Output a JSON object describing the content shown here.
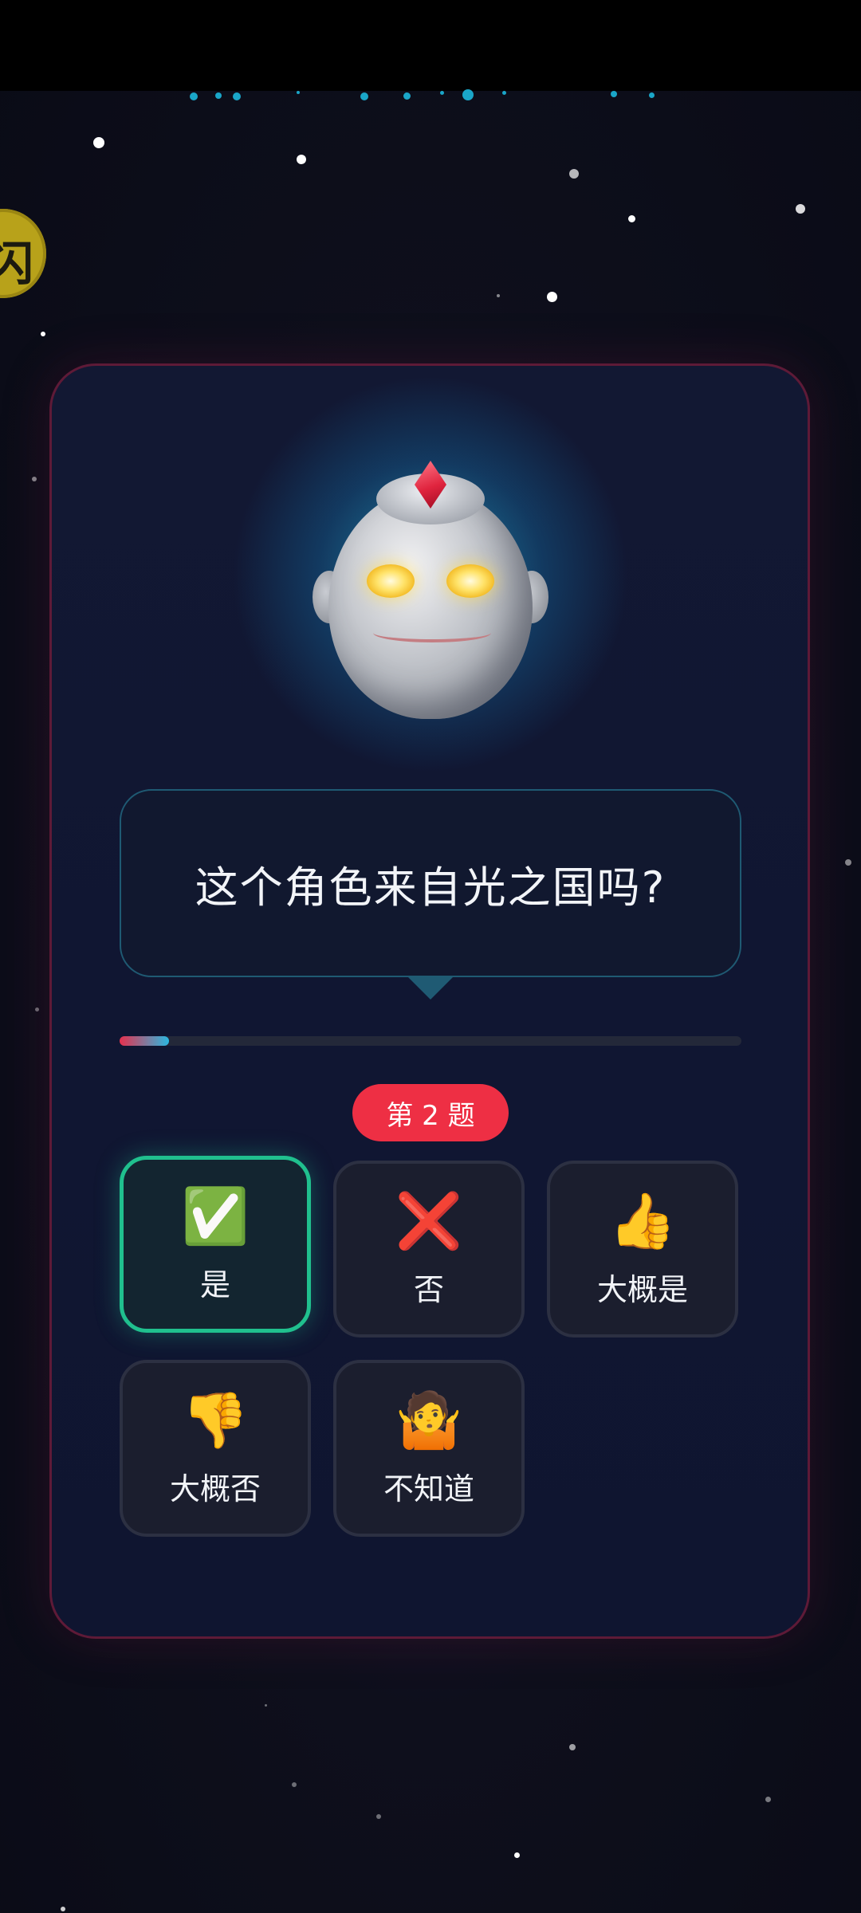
{
  "question": {
    "text": "这个角色来自光之国吗?"
  },
  "progress": {
    "fraction": 0.08
  },
  "question_badge": {
    "label": "第 2 题"
  },
  "coin": {
    "glyph": "闪"
  },
  "answers": [
    {
      "label": "是",
      "icon": "✅",
      "icon_name": "check-icon",
      "selected": true
    },
    {
      "label": "否",
      "icon": "❌",
      "icon_name": "cross-icon",
      "selected": false
    },
    {
      "label": "大概是",
      "icon": "👍",
      "icon_name": "thumbs-up-icon",
      "selected": false
    },
    {
      "label": "大概否",
      "icon": "👎",
      "icon_name": "thumbs-down-icon",
      "selected": false
    },
    {
      "label": "不知道",
      "icon": "🤷",
      "icon_name": "shrug-icon",
      "selected": false
    }
  ],
  "colors": {
    "selected_border": "#20c08e",
    "badge": "#ee2f44",
    "card_border": "#5e1a37"
  }
}
